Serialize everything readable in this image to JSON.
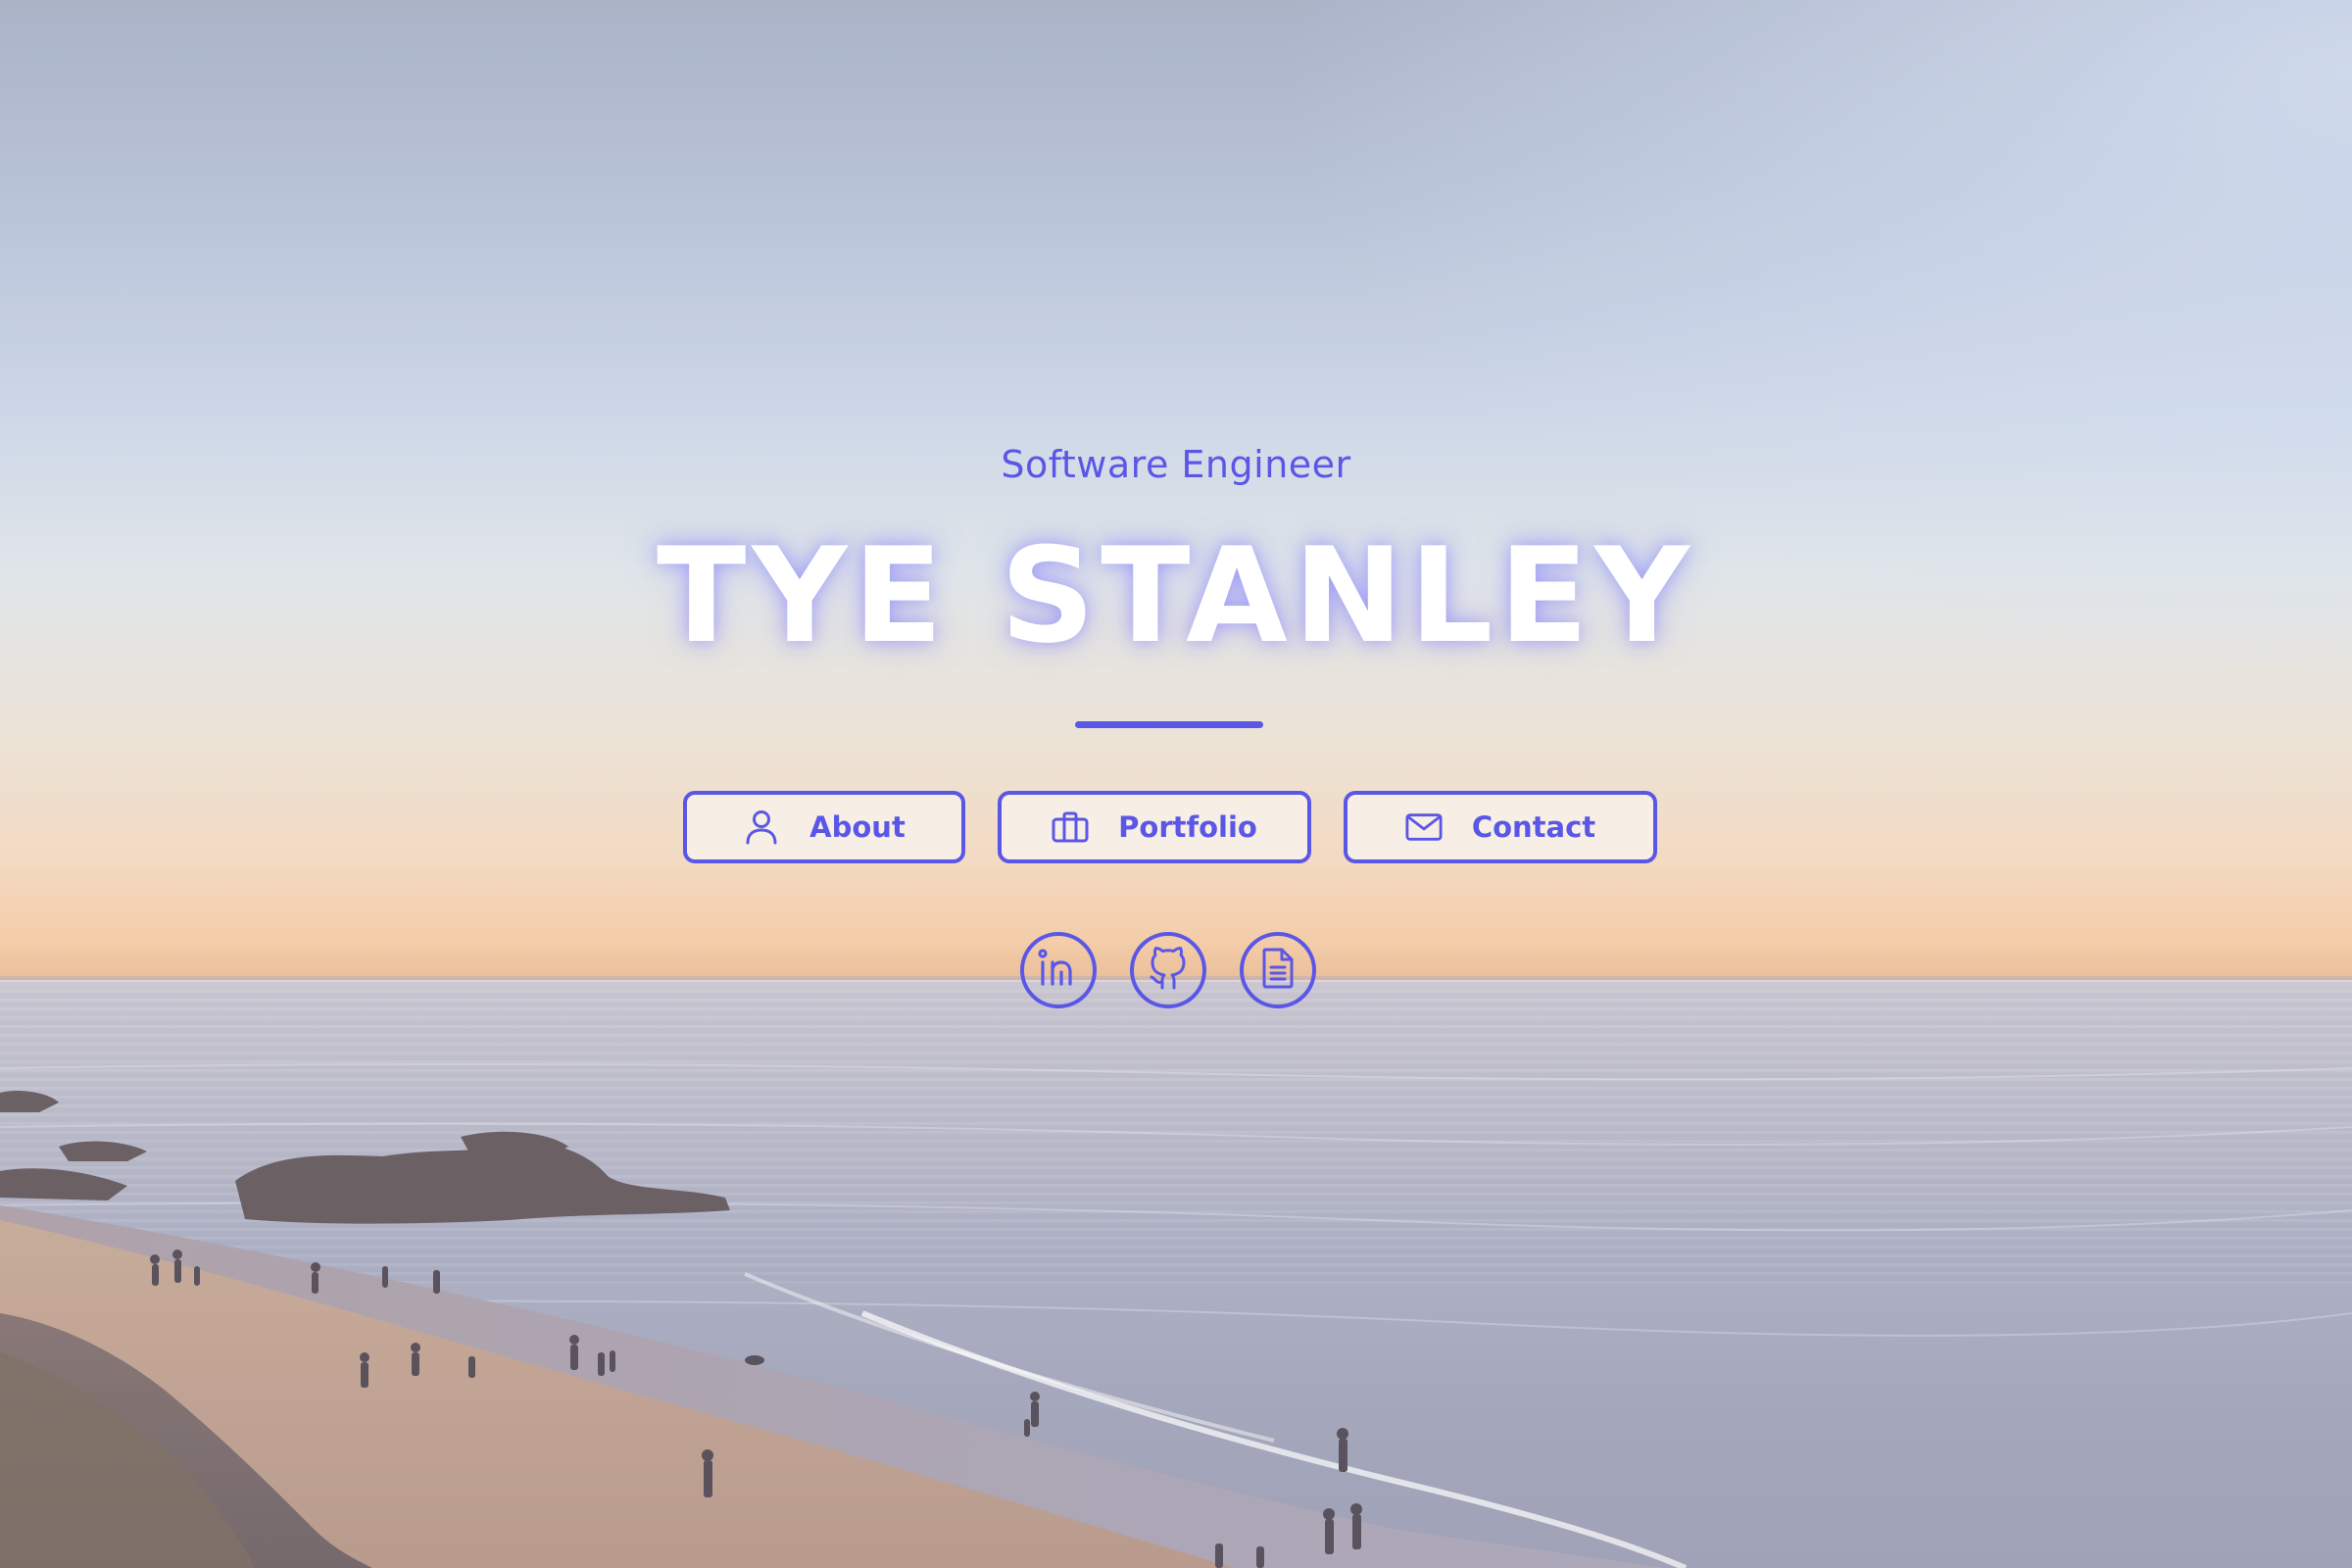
{
  "hero": {
    "subtitle": "Software Engineer",
    "name": "TYE STANLEY"
  },
  "nav": {
    "buttons": [
      {
        "label": "About",
        "icon": "user-icon"
      },
      {
        "label": "Portfolio",
        "icon": "briefcase-icon"
      },
      {
        "label": "Contact",
        "icon": "mail-icon"
      }
    ]
  },
  "social": {
    "links": [
      {
        "icon": "linkedin-icon"
      },
      {
        "icon": "github-icon"
      },
      {
        "icon": "document-icon"
      }
    ]
  },
  "colors": {
    "accent": "#5b57e6",
    "title": "#ffffff",
    "button_bg": "#f7f1e9"
  }
}
